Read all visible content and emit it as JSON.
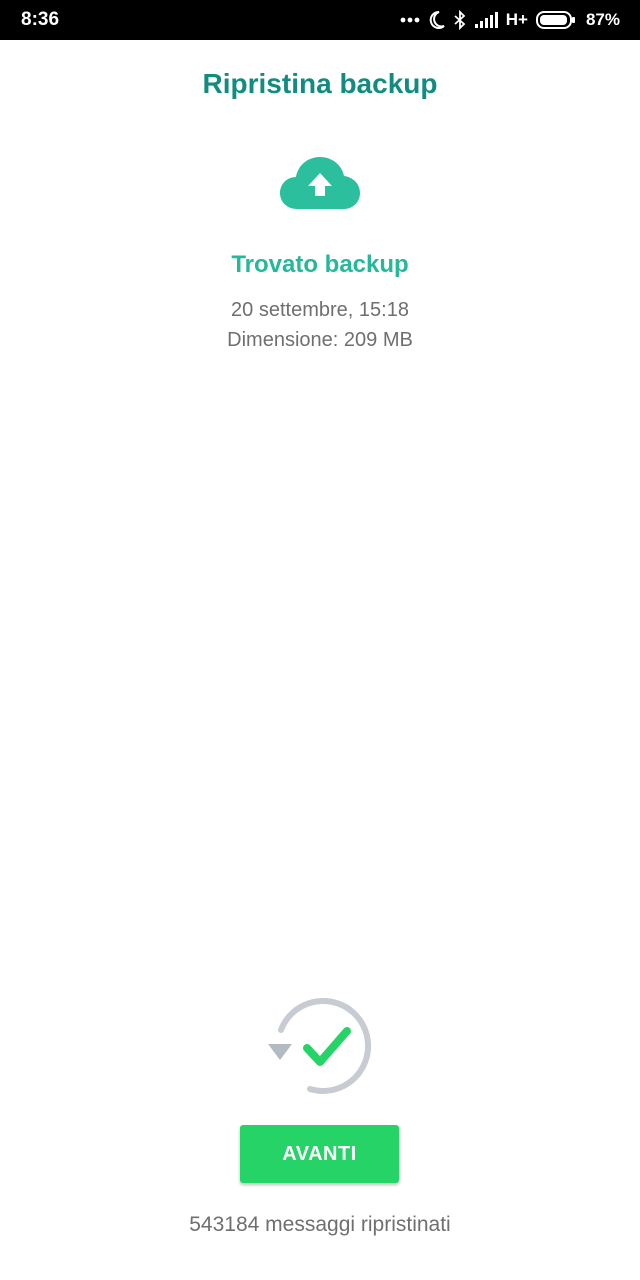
{
  "status_bar": {
    "time": "8:36",
    "network": "H+",
    "battery": "87%",
    "icons": [
      "more-dots-icon",
      "moon-icon",
      "bluetooth-icon",
      "signal-icon",
      "network-icon",
      "battery-icon"
    ]
  },
  "header": {
    "title": "Ripristina backup"
  },
  "backup": {
    "icon": "cloud-upload-icon",
    "found_title": "Trovato backup",
    "date": "20 settembre, 15:18",
    "size": "Dimensione: 209 MB"
  },
  "restore": {
    "icon": "restore-complete-icon",
    "button_label": "AVANTI",
    "restored_text": "543184 messaggi ripristinati"
  },
  "colors": {
    "title_teal": "#128c7e",
    "accent_green": "#25d366",
    "found_teal": "#25b89b",
    "cloud_teal": "#2bbf9e",
    "check_green": "#25d366",
    "restore_gray": "#c6ccd1",
    "text_gray": "#6f6f6f"
  }
}
